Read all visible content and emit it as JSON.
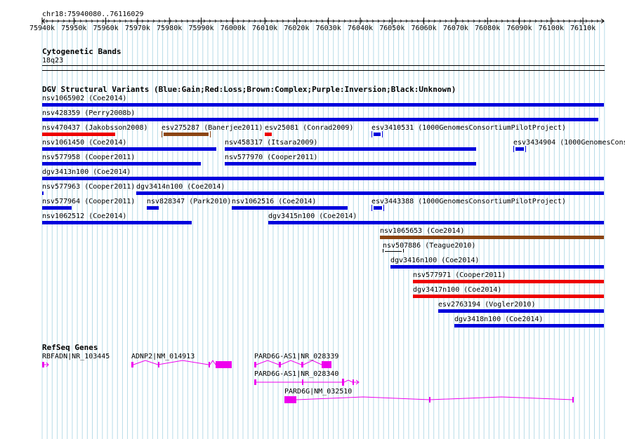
{
  "ruler": {
    "location": "chr18:75940080..76116029",
    "ticks": [
      "75940k",
      "75950k",
      "75960k",
      "75970k",
      "75980k",
      "75990k",
      "76000k",
      "76010k",
      "76020k",
      "76030k",
      "76040k",
      "76050k",
      "76060k",
      "76070k",
      "76080k",
      "76090k",
      "76100k",
      "76110k"
    ]
  },
  "cytoband": {
    "title": "Cytogenetic Bands",
    "band": "18q23"
  },
  "dgv": {
    "title": "DGV Structural Variants (Blue:Gain;Red:Loss;Brown:Complex;Purple:Inversion;Black:Unknown)",
    "legend_colors": {
      "gain": "#0000dd",
      "loss": "#ee0000",
      "complex": "#8b4513",
      "inversion": "#800080",
      "unknown": "#000000"
    },
    "features": [
      {
        "label": "nsv1065902 (Coe2014)",
        "type": "gain"
      },
      {
        "label": "nsv428359 (Perry2008b)",
        "type": "gain"
      },
      {
        "label": "nsv470437 (Jakobsson2008)",
        "type": "loss"
      },
      {
        "label": "esv275287 (Banerjee2011)",
        "type": "complex"
      },
      {
        "label": "esv25081 (Conrad2009)",
        "type": "loss"
      },
      {
        "label": "esv3410531 (1000GenomesConsortiumPilotProject)",
        "type": "gain"
      },
      {
        "label": "nsv1061450 (Coe2014)",
        "type": "gain"
      },
      {
        "label": "nsv458317 (Itsara2009)",
        "type": "gain"
      },
      {
        "label": "esv3434904 (1000GenomesCons",
        "type": "gain"
      },
      {
        "label": "nsv577958 (Cooper2011)",
        "type": "gain"
      },
      {
        "label": "nsv577970 (Cooper2011)",
        "type": "gain"
      },
      {
        "label": "dgv3413n100 (Coe2014)",
        "type": "gain"
      },
      {
        "label": "nsv577963 (Cooper2011)",
        "type": "gain"
      },
      {
        "label": "dgv3414n100 (Coe2014)",
        "type": "gain"
      },
      {
        "label": "nsv577964 (Cooper2011)",
        "type": "gain"
      },
      {
        "label": "nsv828347 (Park2010)",
        "type": "gain"
      },
      {
        "label": "nsv1062516 (Coe2014)",
        "type": "gain"
      },
      {
        "label": "esv3443388 (1000GenomesConsortiumPilotProject)",
        "type": "gain"
      },
      {
        "label": "nsv1062512 (Coe2014)",
        "type": "gain"
      },
      {
        "label": "dgv3415n100 (Coe2014)",
        "type": "gain"
      },
      {
        "label": "nsv1065653 (Coe2014)",
        "type": "complex"
      },
      {
        "label": "nsv507886 (Teague2010)",
        "type": "unknown"
      },
      {
        "label": "dgv3416n100 (Coe2014)",
        "type": "gain"
      },
      {
        "label": "nsv577971 (Cooper2011)",
        "type": "loss"
      },
      {
        "label": "dgv3417n100 (Coe2014)",
        "type": "loss"
      },
      {
        "label": "esv2763194 (Vogler2010)",
        "type": "gain"
      },
      {
        "label": "dgv3418n100 (Coe2014)",
        "type": "gain"
      }
    ]
  },
  "refseq": {
    "title": "RefSeq Genes",
    "gene_color": "#ee00ee",
    "genes": [
      {
        "label": "RBFADN|NR_103445"
      },
      {
        "label": "ADNP2|NM_014913"
      },
      {
        "label": "PARD6G-AS1|NR_028339"
      },
      {
        "label": "PARD6G-AS1|NR_028340"
      },
      {
        "label": "PARD6G|NM_032510"
      }
    ]
  }
}
